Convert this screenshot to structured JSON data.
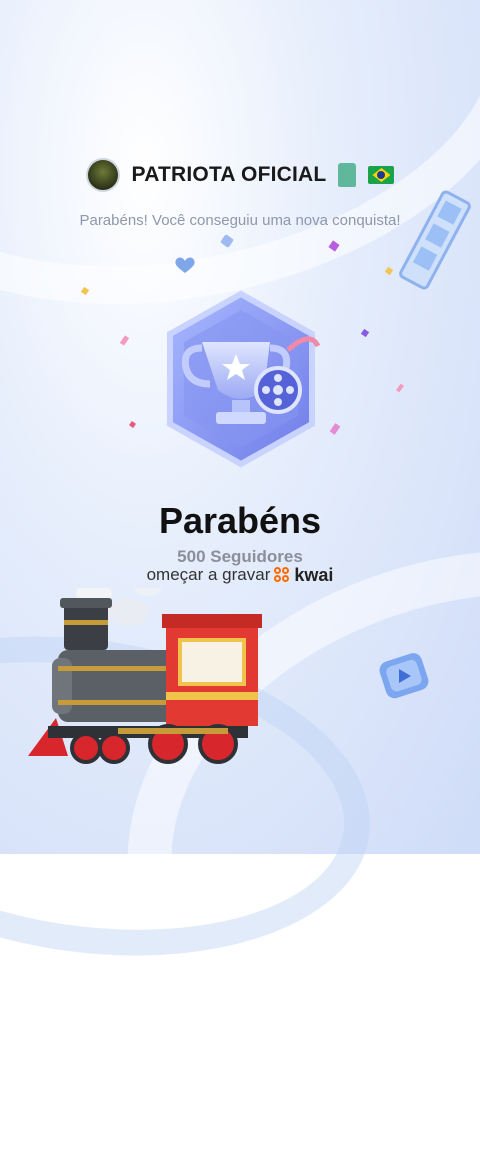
{
  "header": {
    "username": "PATRIOTA OFICIAL",
    "statue_icon": "statue-of-liberty-icon",
    "flag_icon": "brazil-flag-icon",
    "subtitle": "Parabéns! Você conseguiu uma nova conquista!"
  },
  "achievement": {
    "title": "Parabéns",
    "milestone": "500 Seguidores",
    "record_text": "omeçar a gravar",
    "brand": "kwai"
  },
  "colors": {
    "badge_primary": "#7b87f0",
    "badge_secondary": "#a7b6ff",
    "kwai_orange": "#ff6a00",
    "train_red": "#e23a32"
  }
}
